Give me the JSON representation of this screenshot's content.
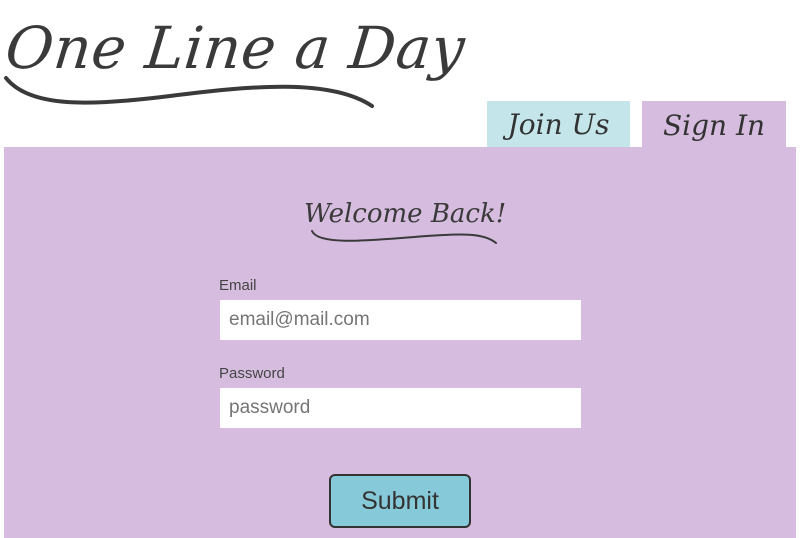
{
  "app": {
    "logo_text": "One Line a Day"
  },
  "tabs": [
    {
      "label": "Join Us",
      "active": false
    },
    {
      "label": "Sign In",
      "active": true
    }
  ],
  "form": {
    "heading": "Welcome Back!",
    "email": {
      "label": "Email",
      "placeholder": "email@mail.com",
      "value": ""
    },
    "password": {
      "label": "Password",
      "placeholder": "password",
      "value": ""
    },
    "submit_label": "Submit"
  },
  "colors": {
    "panel": "#d6bddf",
    "join_tab": "#c4e6ea",
    "sign_in_tab": "#d6bddf",
    "submit_button": "#86cad9",
    "text": "#3a3a3a"
  }
}
